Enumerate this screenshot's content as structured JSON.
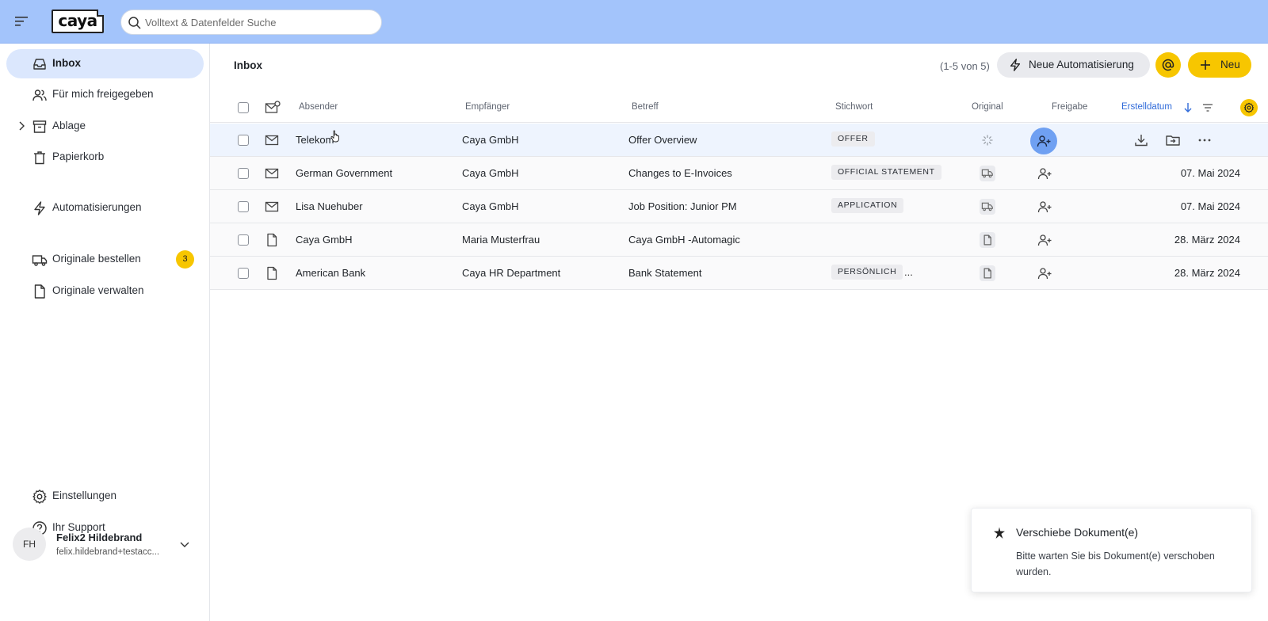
{
  "app": {
    "logo_text": "caya"
  },
  "search": {
    "placeholder": "Volltext & Datenfelder Suche"
  },
  "sidebar": {
    "items": [
      {
        "label": "Inbox",
        "icon": "inbox-icon",
        "active": true
      },
      {
        "label": "Für mich freigegeben",
        "icon": "users-icon"
      },
      {
        "label": "Ablage",
        "icon": "archive-icon",
        "expandable": true
      },
      {
        "label": "Papierkorb",
        "icon": "trash-icon"
      },
      {
        "label": "Automatisierungen",
        "icon": "bolt-icon"
      },
      {
        "label": "Originale bestellen",
        "icon": "truck-icon",
        "badge": "3"
      },
      {
        "label": "Originale verwalten",
        "icon": "file-icon"
      },
      {
        "label": "Einstellungen",
        "icon": "gear-icon"
      },
      {
        "label": "Ihr Support",
        "icon": "help-icon"
      }
    ],
    "user": {
      "initials": "FH",
      "name": "Felix2 Hildebrand",
      "email": "felix.hildebrand+testacc..."
    }
  },
  "main": {
    "title": "Inbox",
    "count": "(1-5 von 5)",
    "automation_button": "Neue Automatisierung",
    "new_button": "Neu",
    "columns": {
      "sender": "Absender",
      "recipient": "Empfänger",
      "subject": "Betreff",
      "keyword": "Stichwort",
      "original": "Original",
      "share": "Freigabe",
      "created": "Erstelldatum"
    },
    "rows": [
      {
        "type": "mail-icon",
        "sender": "Telekom",
        "recipient": "Caya GmbH",
        "subject": "Offer Overview",
        "tag": "OFFER",
        "original": "loading-icon",
        "date": ""
      },
      {
        "type": "mail-icon",
        "sender": "German Government",
        "recipient": "Caya GmbH",
        "subject": "Changes to E-Invoices",
        "tag": "OFFICIAL STATEMENT",
        "original": "truck-icon",
        "date": "07. Mai 2024"
      },
      {
        "type": "mail-icon",
        "sender": "Lisa Nuehuber",
        "recipient": "Caya GmbH",
        "subject": "Job Position: Junior PM",
        "tag": "APPLICATION",
        "original": "truck-icon",
        "date": "07. Mai 2024"
      },
      {
        "type": "file-icon",
        "sender": "Caya GmbH",
        "recipient": "Maria Musterfrau",
        "subject": "Caya GmbH -Automagic",
        "tag": "",
        "original": "file-icon",
        "date": "28. März 2024"
      },
      {
        "type": "file-icon",
        "sender": "American Bank",
        "recipient": "Caya HR Department",
        "subject": "Bank Statement",
        "tag": "PERSÖNLICH",
        "more": "...",
        "original": "file-icon",
        "date": "28. März 2024"
      }
    ]
  },
  "toast": {
    "title": "Verschiebe Dokument(e)",
    "message": "Bitte warten Sie bis Dokument(e) verschoben wurden."
  },
  "colors": {
    "topbar": "#a3c4fb",
    "accent_yellow": "#f7c600",
    "active_nav": "#dbe7fd",
    "sort_blue": "#2f6ad9"
  }
}
